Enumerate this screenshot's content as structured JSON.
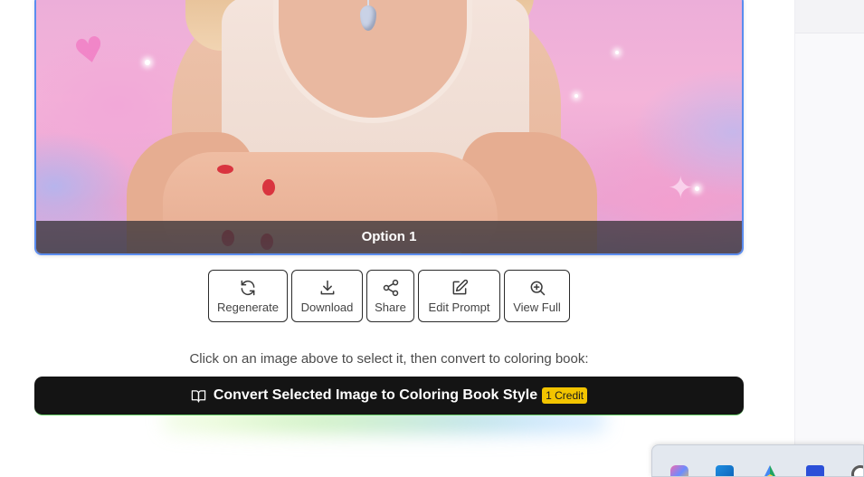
{
  "image_card": {
    "caption": "Option 1"
  },
  "actions": [
    {
      "label": "Regenerate",
      "icon": "refresh-icon"
    },
    {
      "label": "Download",
      "icon": "download-icon"
    },
    {
      "label": "Share",
      "icon": "share-icon"
    },
    {
      "label": "Edit Prompt",
      "icon": "edit-icon"
    },
    {
      "label": "View Full",
      "icon": "zoom-in-icon"
    }
  ],
  "hint": "Click on an image above to select it, then convert to coloring book:",
  "convert": {
    "label": "Convert Selected Image to Coloring Book Style",
    "badge": "1 Credit",
    "icon": "book-icon"
  },
  "taskbar": {
    "apps": [
      "copilot-icon",
      "store-icon",
      "drive-icon",
      "mail-icon",
      "google-icon"
    ]
  },
  "colors": {
    "selection_border": "#5b8def",
    "convert_bg": "#141414",
    "badge_bg": "#f2c400"
  }
}
